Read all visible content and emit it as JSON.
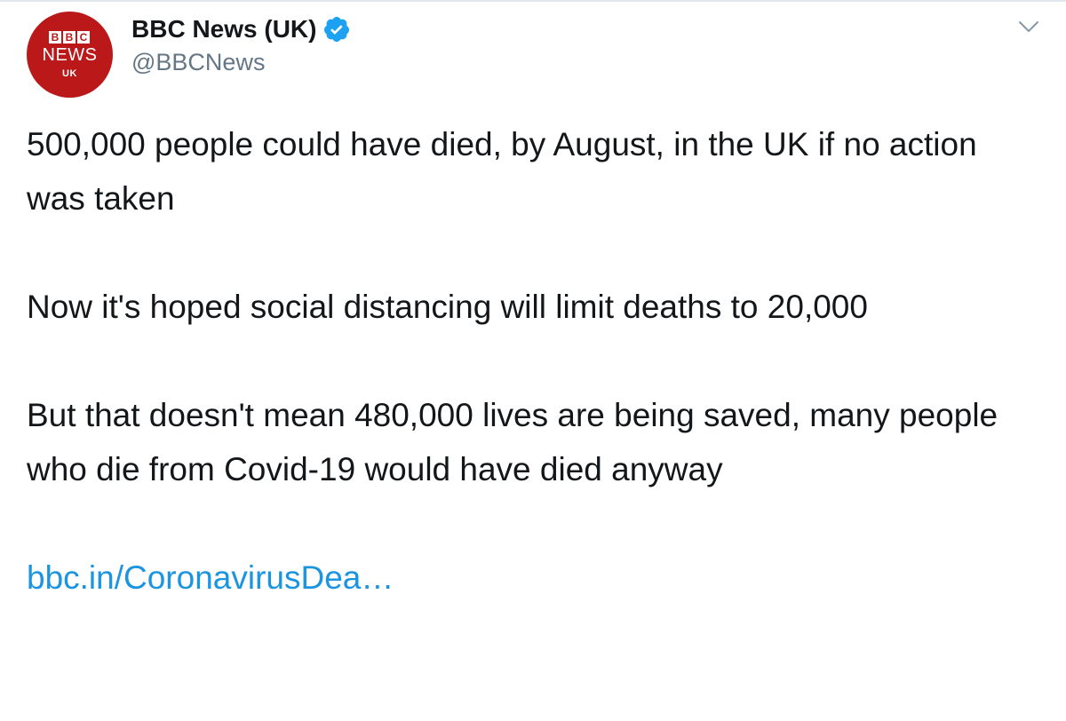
{
  "avatar": {
    "blocks": [
      "B",
      "B",
      "C"
    ],
    "wordmark": "NEWS",
    "region": "UK"
  },
  "author": {
    "name": "BBC News (UK)",
    "handle": "@BBCNews",
    "verified": true
  },
  "tweet": {
    "paragraphs": [
      "500,000 people could have died, by August, in the UK if no action was taken",
      "Now it's hoped social distancing will limit deaths to 20,000",
      "But that doesn't mean 480,000 lives are being saved, many people who die from Covid-19 would have died anyway"
    ],
    "link": "bbc.in/CoronavirusDea…"
  },
  "icons": {
    "verified": "verified-badge-icon",
    "menu": "chevron-down-icon"
  },
  "colors": {
    "brand_red": "#bb1919",
    "verified_blue": "#1da1f2",
    "link_blue": "#1b95e0",
    "text": "#14171a",
    "muted": "#657786"
  }
}
